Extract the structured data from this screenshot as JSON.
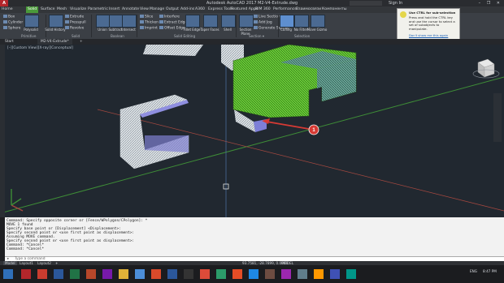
{
  "titlebar": {
    "app_label": "A",
    "title": "Autodesk AutoCAD 2017   M2-V4-Extrude.dwg",
    "sign_in": "Sign In",
    "window_buttons": "– ❐ ✕"
  },
  "menu_tabs": [
    {
      "label": "Home"
    },
    {
      "label": "Solid"
    },
    {
      "label": "Surface"
    },
    {
      "label": "Mesh"
    },
    {
      "label": "Visualize"
    },
    {
      "label": "Parametric"
    },
    {
      "label": "Insert"
    },
    {
      "label": "Annotate"
    },
    {
      "label": "View"
    },
    {
      "label": "Manage"
    },
    {
      "label": "Output"
    },
    {
      "label": "Add-ins"
    },
    {
      "label": "A360"
    },
    {
      "label": "Express Tools"
    },
    {
      "label": "Featured Apps"
    },
    {
      "label": "BIM 360"
    },
    {
      "label": "Performance"
    },
    {
      "label": "Взаимосвязи"
    },
    {
      "label": "Компоненты"
    }
  ],
  "ribbon": {
    "primitive": {
      "items": [
        "Box",
        "Cylinder",
        "Sphere"
      ],
      "big": "Polysolid",
      "group": "Primitive"
    },
    "solid": {
      "items": [
        "Extrude",
        "Presspull",
        "Revolve"
      ],
      "big": "Solid History",
      "group": "Solid"
    },
    "boolean": {
      "items": [
        "Union",
        "Subtract",
        "Intersect"
      ],
      "group": "Boolean"
    },
    "solid_editing": {
      "items": [
        "Slice",
        "Thicken",
        "Imprint",
        "Interfere",
        "Extract Edges",
        "Offset Edge",
        "Fillet Edge",
        "Taper Faces",
        "Shell"
      ],
      "group": "Solid Editing"
    },
    "section": {
      "items": [
        "Section Plane",
        "Live Section",
        "Add Jog",
        "Generate Section"
      ],
      "group": "Section ▾"
    },
    "selection": {
      "items": [
        "Culling",
        "No Filter",
        "Move Gizmo"
      ],
      "group": "Selection"
    }
  },
  "file_tabs": [
    "Start",
    "M2-V4-Extrude*",
    "+"
  ],
  "viewport": {
    "label": "[–][Custom View][X-ray][Conceptual]",
    "marker": "1"
  },
  "command_lines": [
    "Command: Specify opposite corner or [Fence/WPolygon/CPolygon]: *",
    "MOVE 1 found",
    "Specify base point or [Displacement] <Displacement>:",
    "Specify second point or <use first point as displacement>:",
    "Assuming MOVE command.",
    "Specify second point or <use first point as displacement>:",
    "Command: *Cancel*",
    "Command: *Cancel*"
  ],
  "command_input": {
    "placeholder": "Type a command"
  },
  "layout_tabs": [
    "Model",
    "Layout1",
    "Layout2",
    "+"
  ],
  "status": {
    "coords": "93.7581, -28.7899, 0.0000",
    "model": "MODEL"
  },
  "taskbar": {
    "time": "8:47 PM",
    "lang": "ENG"
  },
  "tooltip": {
    "title": "Use CTRL for sub-selection",
    "body": "Press and hold the CTRL key and use the cursor to select a set of subobjects to manipulate.",
    "link": "Don't show me this again"
  }
}
